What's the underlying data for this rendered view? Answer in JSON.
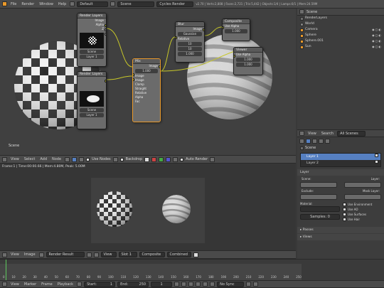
{
  "info_bar": {
    "menus": [
      "File",
      "Render",
      "Window",
      "Help"
    ],
    "layout": "Default",
    "scene": "Scene",
    "engine": "Cycles Render",
    "stats": "v2.70 | Verts:2,808 | Faces:2,721 | Tris:5,442 | Objects:1/4 | Lamps:0/1 | Mem:24.59M"
  },
  "node_editor": {
    "header": [
      "View",
      "Select",
      "Add",
      "Node"
    ],
    "use_nodes_label": "Use Nodes",
    "backdrop_label": "Backdrop",
    "auto_render_label": "Auto Render",
    "scene_label": "Scene",
    "nodes": {
      "render_layers": {
        "title": "Render Layers",
        "rows": [
          "Image",
          "Alpha",
          "Z"
        ],
        "scene": "Scene",
        "layer": "Layer 1"
      },
      "render_layers_2": {
        "title": "Render Layers",
        "scene": "Scene",
        "layer": "Layer 1"
      },
      "mid": {
        "title": "Mix",
        "rows": [
          "Image",
          "Fac",
          "Image",
          "Image",
          "Clamp",
          "Straight",
          "Relative",
          "Alpha",
          "Fac"
        ],
        "fac": "1.000"
      },
      "blur": {
        "title": "Blur",
        "rows": [
          "Image",
          "Gaussian",
          "Relative",
          "X",
          "Y"
        ],
        "x": "10",
        "y": "10",
        "size": "1.000"
      },
      "composite": {
        "title": "Composite",
        "rows": [
          "Image",
          "Use Alpha",
          "Alpha"
        ],
        "alpha": "1.000"
      },
      "viewer": {
        "title": "Viewer",
        "rows": [
          "Image",
          "Use Alpha",
          "Alpha",
          "Z"
        ],
        "alpha": "1.000",
        "z": "1.000"
      }
    }
  },
  "image_editor": {
    "status": "Frame:1 | Time:00:00.66 | Mem:4.80M, Peak: 5.00M",
    "header": [
      "View",
      "Image"
    ],
    "image_name": "Render Result",
    "view": "View",
    "slot": "Slot 1",
    "layer": "Composite",
    "pass": "Combined"
  },
  "outliner": {
    "header": "Scene",
    "items": [
      "RenderLayers",
      "World",
      "Camera",
      "Sphere",
      "Sphere.001",
      "Sun"
    ]
  },
  "properties": {
    "header": [
      "View",
      "Search",
      "All Scenes"
    ],
    "scene_crumb": "Scene",
    "layers": [
      "Layer 1",
      "Layer 2"
    ],
    "layer_panel": "Layer",
    "layer_labels": [
      "Scene:",
      "Layer:",
      "Exclude:",
      "Mask Layer:"
    ],
    "material_label": "Material:",
    "samples_label": "Samples: 0",
    "checks": [
      "Use Environment",
      "Use AO",
      "Use Surfaces",
      "Use Hair"
    ],
    "collapsed": [
      "Passes",
      "Views"
    ]
  },
  "timeline": {
    "ticks": [
      "0",
      "10",
      "20",
      "30",
      "40",
      "50",
      "60",
      "70",
      "80",
      "90",
      "100",
      "110",
      "120",
      "130",
      "140",
      "150",
      "160",
      "170",
      "180",
      "190",
      "200",
      "210",
      "220",
      "230",
      "240",
      "250"
    ],
    "header": [
      "View",
      "Marker",
      "Frame",
      "Playback"
    ],
    "start_label": "Start:",
    "start": "1",
    "end_label": "End:",
    "end": "250",
    "current": "1",
    "sync": "No Sync"
  },
  "colors": {
    "accent": "#e9992b",
    "selected": "#5680c2",
    "socket_yellow": "#c7c729",
    "socket_grey": "#a1a1a1",
    "socket_purple": "#6363c7"
  }
}
